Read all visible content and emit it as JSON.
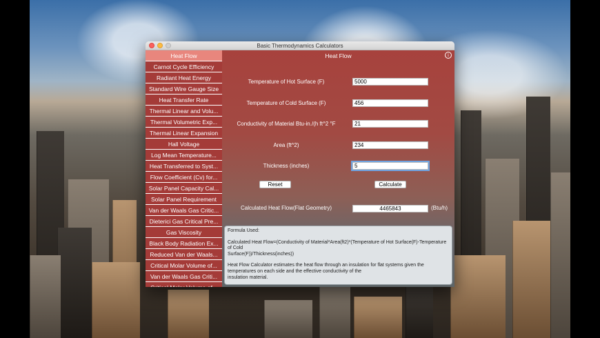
{
  "window": {
    "title": "Basic Thermodynamics Calculators"
  },
  "sidebar": {
    "items": [
      {
        "label": "Heat Flow",
        "selected": true
      },
      {
        "label": "Carnot Cycle Efficiency"
      },
      {
        "label": "Radiant Heat Energy"
      },
      {
        "label": "Standard Wire Gauge Size"
      },
      {
        "label": "Heat Transfer Rate"
      },
      {
        "label": "Thermal Linear and Volu..."
      },
      {
        "label": "Thermal Volumetric Exp..."
      },
      {
        "label": "Thermal Linear Expansion"
      },
      {
        "label": "Hall Voltage"
      },
      {
        "label": "Log Mean Temperature..."
      },
      {
        "label": "Heat Transferred to Syst..."
      },
      {
        "label": "Flow Coefficient (Cv) for..."
      },
      {
        "label": "Solar Panel Capacity Cal..."
      },
      {
        "label": "Solar Panel Requirement"
      },
      {
        "label": "Van der Waals Gas Critic..."
      },
      {
        "label": "Dieterici Gas Critical Pre..."
      },
      {
        "label": "Gas Viscosity"
      },
      {
        "label": "Black Body Radiation Ex..."
      },
      {
        "label": "Reduced Van der Waals..."
      },
      {
        "label": "Critical Molar Volume of..."
      },
      {
        "label": "Van der Waals Gas Criti..."
      },
      {
        "label": "Critical Molar Volume of..."
      }
    ]
  },
  "main": {
    "title": "Heat Flow",
    "info_icon": "info-icon",
    "fields": {
      "hot_label": "Temperature of Hot Surface (F)",
      "hot_value": "5000",
      "cold_label": "Temperature of Cold Surface (F)",
      "cold_value": "456",
      "conductivity_label": "Conductivity of Material Btu-in./(h ft^2 °F",
      "conductivity_value": "21",
      "area_label": "Area (ft^2)",
      "area_value": "234",
      "thickness_label": "Thickness (inches)",
      "thickness_value": "5"
    },
    "reset_label": "Reset",
    "calculate_label": "Calculate",
    "result_label": "Calculated Heat Flow(Flat Geometry)",
    "result_value": "4465843",
    "result_unit": "(Btu/h)",
    "formula": {
      "heading": "Formula Used:",
      "line1": "Calculated Heat Flow=(Conductivity of Material*Area(ft2)*(Temperature of Hot Surface(F)-Temperature of Cold",
      "line2": "Surface(F))/Thickness(inches))",
      "desc1": "Heat Flow Calculator estimates the heat flow through an insulation for flat systems given the temperatures on each side and the effective conductivity of the",
      "desc2": "insulation material."
    }
  },
  "colors": {
    "sidebar_item": "#a43b38",
    "sidebar_selected": "#e8867d",
    "panel_top": "#a7423d",
    "panel_bottom": "#5d6568"
  }
}
